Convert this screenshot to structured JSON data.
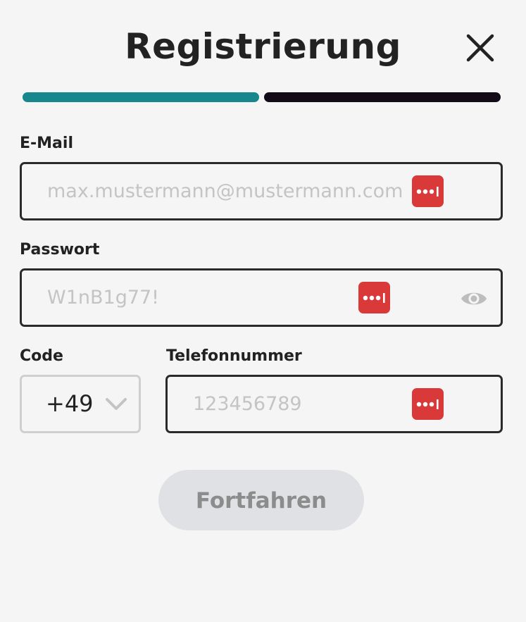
{
  "header": {
    "title": "Registrierung",
    "close_icon": "close-icon"
  },
  "progress": {
    "current_step": 1,
    "total_steps": 2,
    "active_color": "#17868d",
    "inactive_color": "#130b18"
  },
  "form": {
    "email": {
      "label": "E-Mail",
      "value": "",
      "placeholder": "max.mustermann@mustermann.com"
    },
    "password": {
      "label": "Passwort",
      "value": "",
      "placeholder": "W1nB1g77!",
      "toggle_icon": "eye-icon"
    },
    "code": {
      "label": "Code",
      "selected": "+49",
      "icon": "chevron-down-icon"
    },
    "phone": {
      "label": "Telefonnummer",
      "value": "",
      "placeholder": "123456789"
    },
    "password_manager_icon": "password-manager-icon",
    "password_manager_color": "#d93a39"
  },
  "actions": {
    "continue_label": "Fortfahren",
    "continue_enabled": false
  }
}
